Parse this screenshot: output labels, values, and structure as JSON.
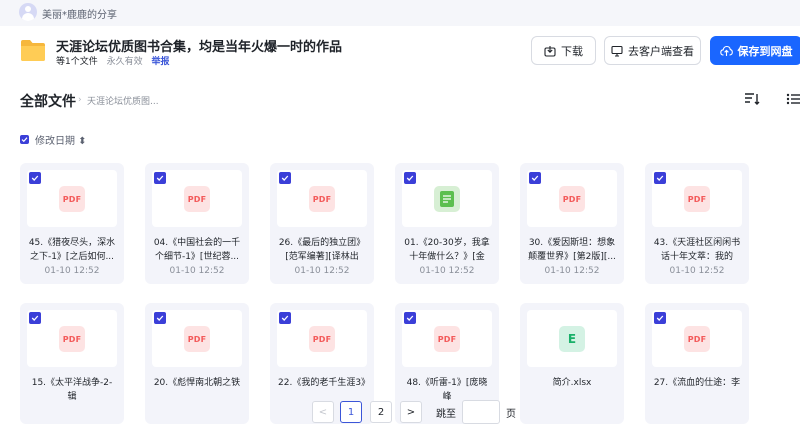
{
  "sharer": "美丽*鹿鹿的分享",
  "share": {
    "title": "天涯论坛优质图书合集，均是当年火爆一时的作品",
    "file_count": "等1个文件",
    "validity": "永久有效",
    "report": "举报"
  },
  "actions": {
    "download": "下载",
    "open_client": "去客户端查看",
    "save": "保存到网盘"
  },
  "breadcrumb": {
    "root": "全部文件",
    "separator": "›",
    "current": "天涯论坛优质图..."
  },
  "sort": {
    "label": "修改日期 ⬍"
  },
  "file_type_labels": {
    "pdf": "PDF",
    "xlsx": "E"
  },
  "files": [
    {
      "name": "45.《猎夜尽头，深水之下-1》[之后如何...",
      "date": "01-10 12:52",
      "type": "pdf"
    },
    {
      "name": "04.《中国社会的一千个细节-1》[世纪蓉...",
      "date": "01-10 12:52",
      "type": "pdf"
    },
    {
      "name": "26.《最后的独立团》[范军编著][译林出版...",
      "date": "01-10 12:52",
      "type": "pdf"
    },
    {
      "name": "01.《20-30岁，我拿十年做什么？》[金正...",
      "date": "01-10 12:52",
      "type": "doc"
    },
    {
      "name": "30.《爱因斯坦：想象颠覆世界》[第2版][...",
      "date": "01-10 12:52",
      "type": "pdf"
    },
    {
      "name": "43.《天涯社区闲闲书话十年文萃：我的青...",
      "date": "01-10 12:52",
      "type": "pdf"
    },
    {
      "name": "15.《太平洋战争-2-辑",
      "date": "",
      "type": "pdf"
    },
    {
      "name": "20.《彪悍南北朝之铁",
      "date": "",
      "type": "pdf"
    },
    {
      "name": "22.《我的老千生涯3》",
      "date": "",
      "type": "pdf"
    },
    {
      "name": "48.《听雷-1》[庞晓峰",
      "date": "",
      "type": "pdf"
    },
    {
      "name": "简介.xlsx",
      "date": "",
      "type": "xlsx"
    },
    {
      "name": "27.《流血的仕途：李",
      "date": "",
      "type": "pdf"
    }
  ],
  "pagination": {
    "prev": "<",
    "pages": [
      "1",
      "2"
    ],
    "next": ">",
    "jump_label": "跳至",
    "page_unit": "页"
  }
}
